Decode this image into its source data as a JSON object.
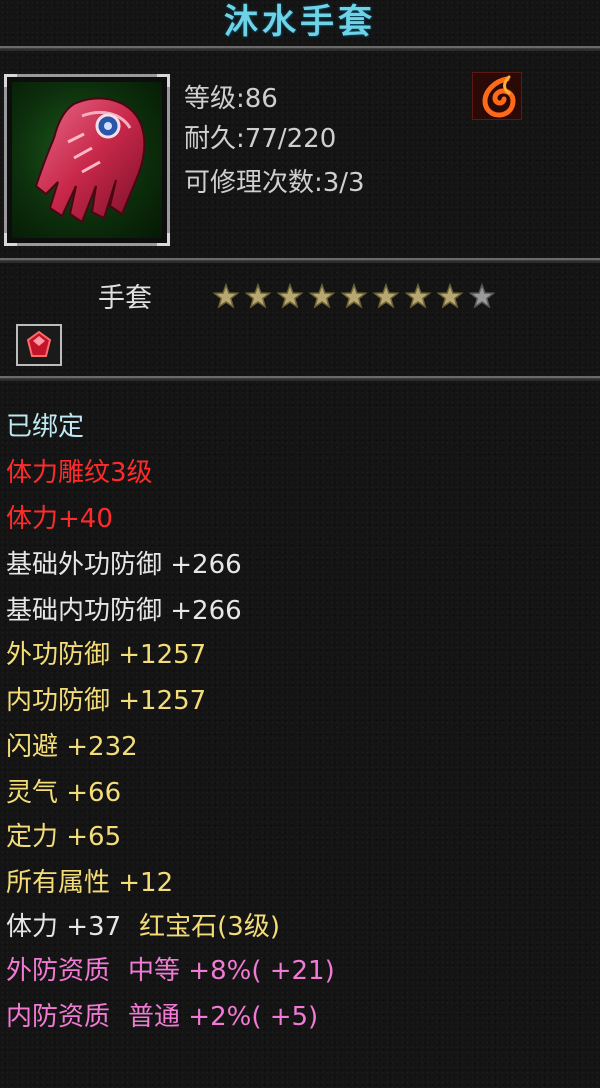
{
  "item": {
    "name": "沐水手套",
    "level_line": "等级:86",
    "durability_line": "耐久:77/220",
    "repair_line": "可修理次数:3/3",
    "type": "手套",
    "stars": {
      "filled": 8,
      "total": 9
    },
    "badge_icon": "fire-emblem-icon",
    "item_icon": "crimson-glove-icon",
    "gem_slot_icon": "red-gem-icon"
  },
  "attributes": [
    {
      "text": "已绑定",
      "color": "cyan"
    },
    {
      "text": "体力雕纹3级",
      "color": "red"
    },
    {
      "text": "体力+40",
      "color": "red"
    },
    {
      "text": "基础外功防御 +266",
      "color": "white"
    },
    {
      "text": "基础内功防御 +266",
      "color": "white"
    },
    {
      "text": "外功防御 +1257",
      "color": "yellow"
    },
    {
      "text": "内功防御 +1257",
      "color": "yellow"
    },
    {
      "text": "闪避 +232",
      "color": "yellow"
    },
    {
      "text": "灵气 +66",
      "color": "yellow"
    },
    {
      "text": "定力 +65",
      "color": "yellow"
    },
    {
      "text": "所有属性 +12",
      "color": "yellow"
    },
    {
      "text": "体力 +37",
      "color": "white",
      "extra": "红宝石(3级)",
      "extra_color": "yellow"
    },
    {
      "text": "外防资质",
      "color": "pink",
      "extra": "中等 +8%( +21)",
      "extra_color": "pink"
    },
    {
      "text": "内防资质",
      "color": "pink",
      "extra": "普通 +2%( +5)",
      "extra_color": "pink"
    }
  ],
  "colors": {
    "title": "#6fd3e8",
    "red": "#ff2b2b",
    "yellow": "#f4dd78",
    "pink": "#f17ad4",
    "cyan": "#bfe9f2",
    "star_filled": "#b8a870",
    "star_empty": "#9a9a9a"
  }
}
